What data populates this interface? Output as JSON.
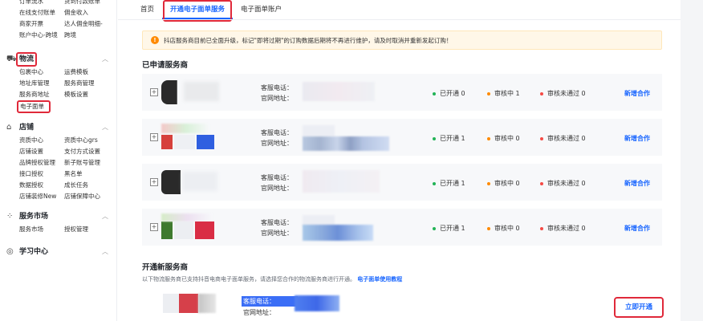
{
  "sidebar": {
    "top_grid": [
      [
        "订单流水",
        "货到付款账单"
      ],
      [
        "在线支付账单",
        "佣金收入"
      ],
      [
        "商家开票",
        "达人佣金明细-"
      ],
      [
        "账户中心-跨境",
        "跨境"
      ]
    ],
    "sections": [
      {
        "title": "物流",
        "grid": [
          [
            "包裹中心",
            "运费模板"
          ],
          [
            "地址库管理",
            "服务商管理"
          ],
          [
            "服务商地址",
            "模板设置"
          ],
          [
            "电子面单",
            ""
          ]
        ]
      },
      {
        "title": "店铺",
        "grid": [
          [
            "资质中心",
            "资质中心grs"
          ],
          [
            "店铺设置",
            "支付方式设置"
          ],
          [
            "品牌授权管理",
            "新子账号管理"
          ],
          [
            "接口授权",
            "黑名单"
          ],
          [
            "数据授权",
            "成长任务"
          ],
          [
            "店铺装修New",
            "店铺保障中心"
          ]
        ]
      },
      {
        "title": "服务市场",
        "grid": [
          [
            "服务市场",
            "授权管理"
          ]
        ]
      },
      {
        "title": "学习中心",
        "grid": []
      }
    ]
  },
  "tabs": [
    "首页",
    "开通电子面单服务",
    "电子面单账户"
  ],
  "notice": "抖店服务商目前已全面升级，标记\"即将过期\"的订购数据后期将不再进行维护，请及时取消并重新发起订购！",
  "applied": {
    "title": "已申请服务商",
    "phone_label": "客服电话：",
    "site_label": "官网地址：",
    "add_label": "新增合作",
    "rows": [
      {
        "opened": "已开通 0",
        "reviewing": "审核中 1",
        "rejected": "审核未通过 0"
      },
      {
        "opened": "已开通 1",
        "reviewing": "审核中 0",
        "rejected": "审核未通过 0"
      },
      {
        "opened": "已开通 1",
        "reviewing": "审核中 0",
        "rejected": "审核未通过 0"
      },
      {
        "opened": "已开通 1",
        "reviewing": "审核中 0",
        "rejected": "审核未通过 0"
      }
    ]
  },
  "new_section": {
    "title": "开通新服务商",
    "desc": "以下物流服务商已支持抖音电商电子面单服务，请选择您合作的物流服务商进行开通。",
    "tutorial_link": "电子面单使用教程",
    "phone_label": "客服电话：",
    "site_label": "官网地址：",
    "open_button": "立即开通"
  },
  "colors": {
    "accent": "#1966ff",
    "highlight_red": "#e0293a",
    "dot_green": "#22b356",
    "dot_orange": "#ff8a00",
    "dot_red": "#f54a45"
  }
}
